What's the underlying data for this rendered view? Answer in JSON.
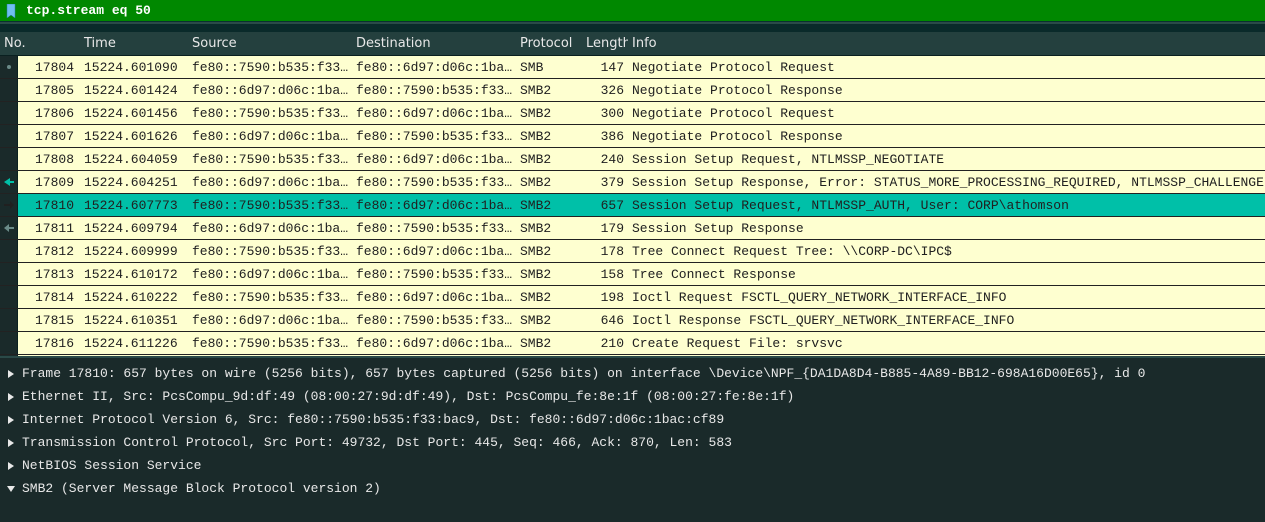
{
  "filter": {
    "value": "tcp.stream eq 50"
  },
  "columns": {
    "no": "No.",
    "time": "Time",
    "source": "Source",
    "destination": "Destination",
    "protocol": "Protocol",
    "length": "Length",
    "info": "Info"
  },
  "packets": [
    {
      "no": "17804",
      "time": "15224.601090",
      "src": "fe80::7590:b535:f33…",
      "dst": "fe80::6d97:d06c:1ba…",
      "proto": "SMB",
      "len": "147",
      "info": "Negotiate Protocol Request",
      "marker": "dot"
    },
    {
      "no": "17805",
      "time": "15224.601424",
      "src": "fe80::6d97:d06c:1ba…",
      "dst": "fe80::7590:b535:f33…",
      "proto": "SMB2",
      "len": "326",
      "info": "Negotiate Protocol Response"
    },
    {
      "no": "17806",
      "time": "15224.601456",
      "src": "fe80::7590:b535:f33…",
      "dst": "fe80::6d97:d06c:1ba…",
      "proto": "SMB2",
      "len": "300",
      "info": "Negotiate Protocol Request"
    },
    {
      "no": "17807",
      "time": "15224.601626",
      "src": "fe80::6d97:d06c:1ba…",
      "dst": "fe80::7590:b535:f33…",
      "proto": "SMB2",
      "len": "386",
      "info": "Negotiate Protocol Response"
    },
    {
      "no": "17808",
      "time": "15224.604059",
      "src": "fe80::7590:b535:f33…",
      "dst": "fe80::6d97:d06c:1ba…",
      "proto": "SMB2",
      "len": "240",
      "info": "Session Setup Request, NTLMSSP_NEGOTIATE"
    },
    {
      "no": "17809",
      "time": "15224.604251",
      "src": "fe80::6d97:d06c:1ba…",
      "dst": "fe80::7590:b535:f33…",
      "proto": "SMB2",
      "len": "379",
      "info": "Session Setup Response, Error: STATUS_MORE_PROCESSING_REQUIRED, NTLMSSP_CHALLENGE",
      "marker": "in"
    },
    {
      "no": "17810",
      "time": "15224.607773",
      "src": "fe80::7590:b535:f33…",
      "dst": "fe80::6d97:d06c:1ba…",
      "proto": "SMB2",
      "len": "657",
      "info": "Session Setup Request, NTLMSSP_AUTH, User: CORP\\athomson",
      "selected": true,
      "marker": "out"
    },
    {
      "no": "17811",
      "time": "15224.609794",
      "src": "fe80::6d97:d06c:1ba…",
      "dst": "fe80::7590:b535:f33…",
      "proto": "SMB2",
      "len": "179",
      "info": "Session Setup Response",
      "marker": "left"
    },
    {
      "no": "17812",
      "time": "15224.609999",
      "src": "fe80::7590:b535:f33…",
      "dst": "fe80::6d97:d06c:1ba…",
      "proto": "SMB2",
      "len": "178",
      "info": "Tree Connect Request Tree: \\\\CORP-DC\\IPC$"
    },
    {
      "no": "17813",
      "time": "15224.610172",
      "src": "fe80::6d97:d06c:1ba…",
      "dst": "fe80::7590:b535:f33…",
      "proto": "SMB2",
      "len": "158",
      "info": "Tree Connect Response"
    },
    {
      "no": "17814",
      "time": "15224.610222",
      "src": "fe80::7590:b535:f33…",
      "dst": "fe80::6d97:d06c:1ba…",
      "proto": "SMB2",
      "len": "198",
      "info": "Ioctl Request FSCTL_QUERY_NETWORK_INTERFACE_INFO"
    },
    {
      "no": "17815",
      "time": "15224.610351",
      "src": "fe80::6d97:d06c:1ba…",
      "dst": "fe80::7590:b535:f33…",
      "proto": "SMB2",
      "len": "646",
      "info": "Ioctl Response FSCTL_QUERY_NETWORK_INTERFACE_INFO"
    },
    {
      "no": "17816",
      "time": "15224.611226",
      "src": "fe80::7590:b535:f33…",
      "dst": "fe80::6d97:d06c:1ba…",
      "proto": "SMB2",
      "len": "210",
      "info": "Create Request File: srvsvc"
    }
  ],
  "details": [
    {
      "expanded": false,
      "text": "Frame 17810: 657 bytes on wire (5256 bits), 657 bytes captured (5256 bits) on interface \\Device\\NPF_{DA1DA8D4-B885-4A89-BB12-698A16D00E65}, id 0"
    },
    {
      "expanded": false,
      "text": "Ethernet II, Src: PcsCompu_9d:df:49 (08:00:27:9d:df:49), Dst: PcsCompu_fe:8e:1f (08:00:27:fe:8e:1f)"
    },
    {
      "expanded": false,
      "text": "Internet Protocol Version 6, Src: fe80::7590:b535:f33:bac9, Dst: fe80::6d97:d06c:1bac:cf89"
    },
    {
      "expanded": false,
      "text": "Transmission Control Protocol, Src Port: 49732, Dst Port: 445, Seq: 466, Ack: 870, Len: 583"
    },
    {
      "expanded": false,
      "text": "NetBIOS Session Service"
    },
    {
      "expanded": true,
      "text": "SMB2 (Server Message Block Protocol version 2)"
    }
  ]
}
